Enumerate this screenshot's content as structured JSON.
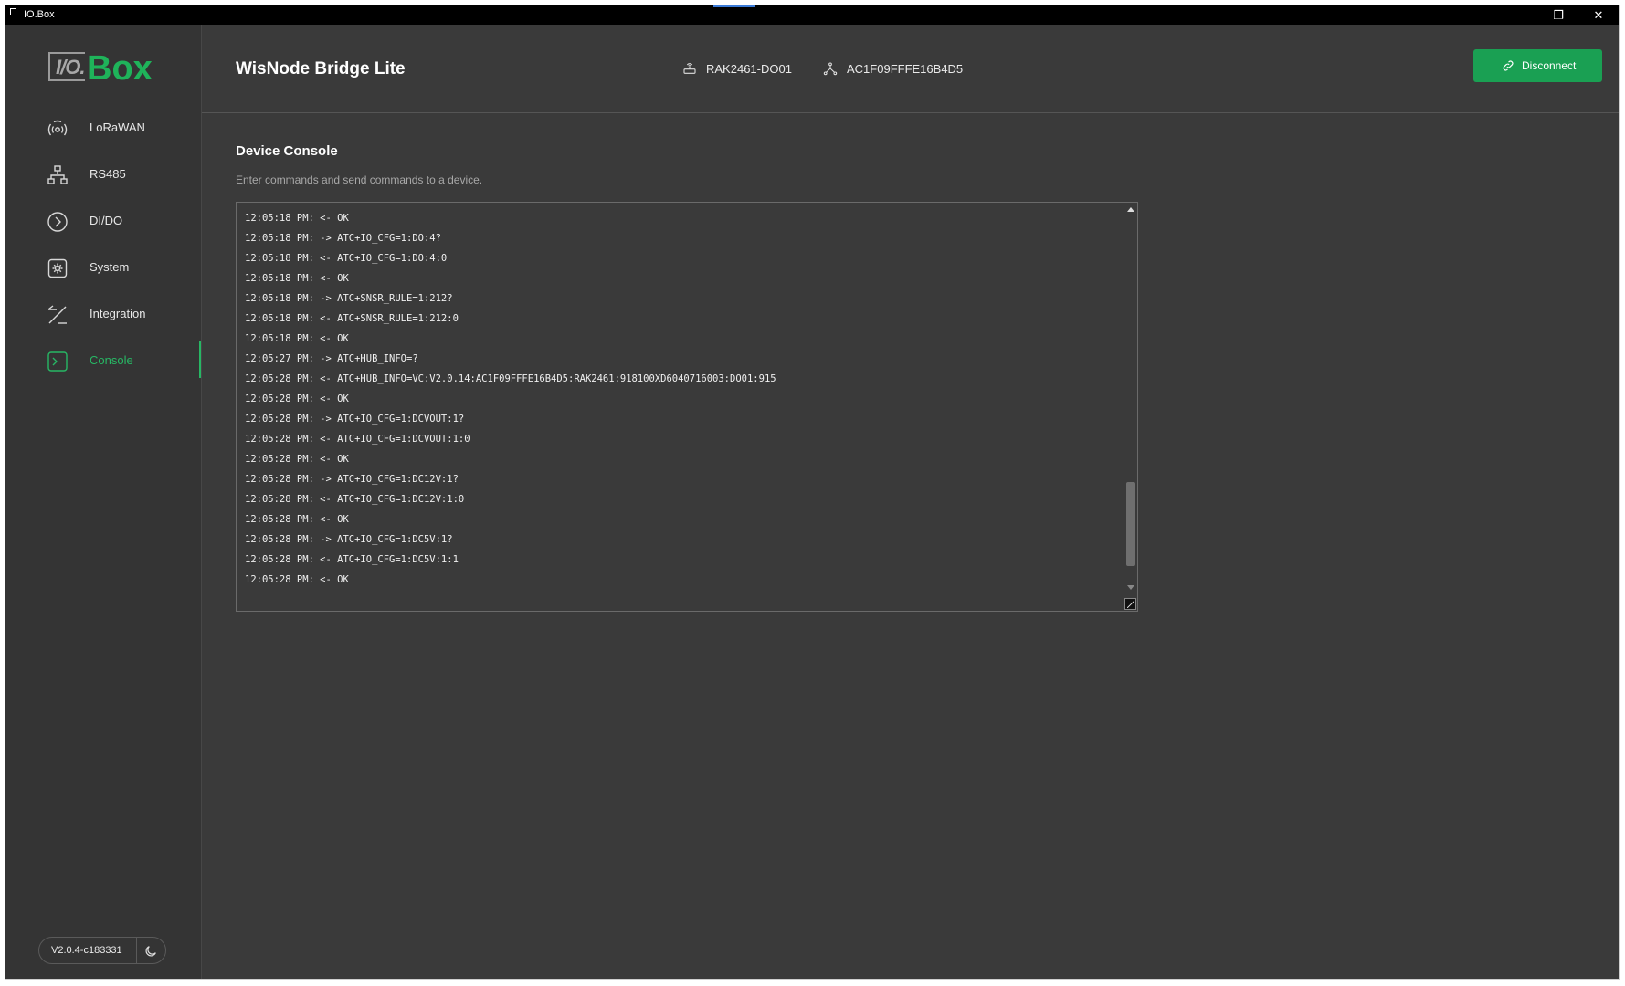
{
  "window": {
    "title": "IO.Box",
    "controls": {
      "minimize": "–",
      "maximize": "❐",
      "close": "✕"
    }
  },
  "logo": {
    "io": "I/O.",
    "box": "Box"
  },
  "sidebar": {
    "items": [
      {
        "label": "LoRaWAN",
        "icon": "lorawan-icon",
        "active": false
      },
      {
        "label": "RS485",
        "icon": "network-icon",
        "active": false
      },
      {
        "label": "DI/DO",
        "icon": "chevron-circle-icon",
        "active": false
      },
      {
        "label": "System",
        "icon": "gear-icon",
        "active": false
      },
      {
        "label": "Integration",
        "icon": "integration-icon",
        "active": false
      },
      {
        "label": "Console",
        "icon": "terminal-icon",
        "active": true
      }
    ],
    "version": "V2.0.4-c183331",
    "theme_icon": "moon-icon"
  },
  "header": {
    "device_title": "WisNode Bridge Lite",
    "model": "RAK2461-DO01",
    "eui": "AC1F09FFFE16B4D5",
    "disconnect_label": "Disconnect"
  },
  "main": {
    "section_title": "Device Console",
    "section_desc": "Enter commands and send commands to a device.",
    "scroll_fraction_top": 0.73,
    "scroll_fraction_size": 0.23
  },
  "console_lines": [
    "12:05:18 PM: <- OK",
    "12:05:18 PM: -> ATC+IO_CFG=1:DO:4?",
    "12:05:18 PM: <- ATC+IO_CFG=1:DO:4:0",
    "12:05:18 PM: <- OK",
    "12:05:18 PM: -> ATC+SNSR_RULE=1:212?",
    "12:05:18 PM: <- ATC+SNSR_RULE=1:212:0",
    "12:05:18 PM: <- OK",
    "12:05:27 PM: -> ATC+HUB_INFO=?",
    "12:05:28 PM: <- ATC+HUB_INFO=VC:V2.0.14:AC1F09FFFE16B4D5:RAK2461:918100XD6040716003:DO01:915",
    "12:05:28 PM: <- OK",
    "12:05:28 PM: -> ATC+IO_CFG=1:DCVOUT:1?",
    "12:05:28 PM: <- ATC+IO_CFG=1:DCVOUT:1:0",
    "12:05:28 PM: <- OK",
    "12:05:28 PM: -> ATC+IO_CFG=1:DC12V:1?",
    "12:05:28 PM: <- ATC+IO_CFG=1:DC12V:1:0",
    "12:05:28 PM: <- OK",
    "12:05:28 PM: -> ATC+IO_CFG=1:DC5V:1?",
    "12:05:28 PM: <- ATC+IO_CFG=1:DC5V:1:1",
    "12:05:28 PM: <- OK"
  ],
  "colors": {
    "accent_green": "#27b764",
    "button_green": "#1aa053",
    "background": "#3a3a3a",
    "sidebar": "#343434"
  }
}
